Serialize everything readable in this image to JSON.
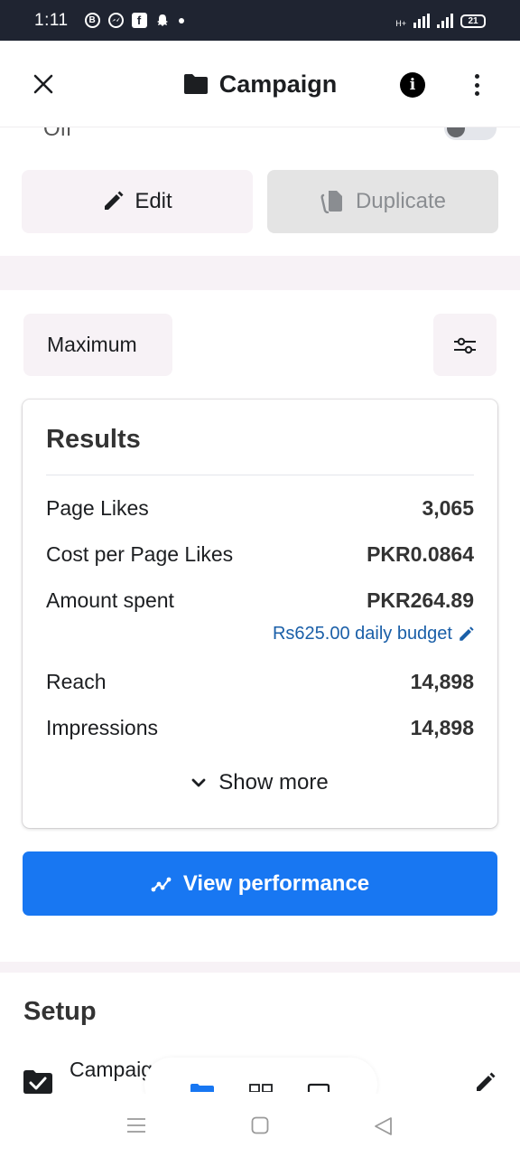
{
  "status_bar": {
    "time": "1:11",
    "battery": "21",
    "network": "H+"
  },
  "header": {
    "title": "Campaign"
  },
  "toggle_row": {
    "label": "Off"
  },
  "actions": {
    "edit_label": "Edit",
    "duplicate_label": "Duplicate"
  },
  "filters": {
    "range_label": "Maximum"
  },
  "results": {
    "title": "Results",
    "metrics": [
      {
        "label": "Page Likes",
        "value": "3,065"
      },
      {
        "label": "Cost per Page Likes",
        "value": "PKR0.0864"
      },
      {
        "label": "Amount spent",
        "value": "PKR264.89"
      },
      {
        "label": "Reach",
        "value": "14,898"
      },
      {
        "label": "Impressions",
        "value": "14,898"
      }
    ],
    "budget_link": "Rs625.00 daily budget",
    "show_more": "Show more"
  },
  "view_performance": "View performance",
  "setup": {
    "title": "Setup",
    "item_label": "Campaign"
  },
  "colors": {
    "primary": "#1877f2",
    "link": "#1a5fa8",
    "soft_bg": "#f7f2f6"
  }
}
